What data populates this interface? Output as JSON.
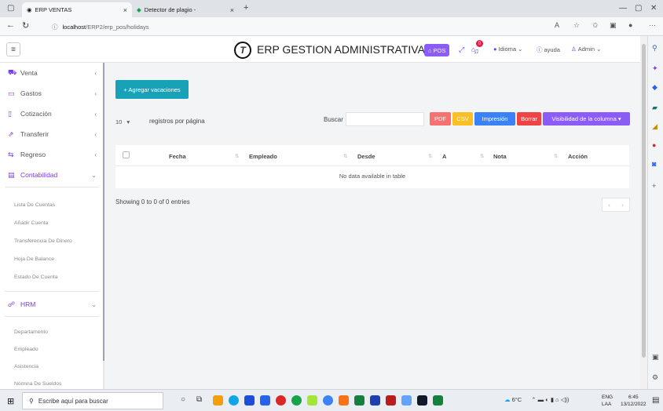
{
  "browser": {
    "tabs": [
      {
        "title": "ERP VENTAS",
        "active": true
      },
      {
        "title": "Detector de plagio -",
        "active": false
      }
    ],
    "new_tab": "+",
    "url_host": "localhost",
    "url_path": "/ERP2/erp_pos/holidays",
    "window_controls": {
      "minimize": "—",
      "restore": "▢",
      "close": "✕"
    }
  },
  "header": {
    "logo_glyph": "T",
    "title": "ERP GESTION ADMINISTRATIVA",
    "pos_label": "POS",
    "notification_count": "0",
    "language_label": "Idioma",
    "help_label": "ayuda",
    "user_label": "Admin"
  },
  "sidebar": {
    "items": [
      {
        "label": "Venta",
        "icon": "cart-icon"
      },
      {
        "label": "Gastos",
        "icon": "folder-icon"
      },
      {
        "label": "Cotización",
        "icon": "document-icon"
      },
      {
        "label": "Transferir",
        "icon": "share-icon"
      },
      {
        "label": "Regreso",
        "icon": "return-icon"
      },
      {
        "label": "Contabilidad",
        "icon": "accounting-icon"
      }
    ],
    "contabilidad_sub": [
      "Lista De Cuentas",
      "Añadir Cuenta",
      "Transferencia De Dinero",
      "Hoja De Balance",
      "Estado De Cuenta"
    ],
    "hrm_label": "HRM",
    "hrm_sub": [
      "Departamento",
      "Empleado",
      "Asistencia",
      "Nómina De Sueldos"
    ]
  },
  "content": {
    "add_button": "+ Agregar vacaciones",
    "page_length": "10",
    "page_length_label": "registros por página",
    "search_label": "Buscar",
    "search_value": "",
    "export_buttons": [
      {
        "label": "PDF",
        "color": "#f87171"
      },
      {
        "label": "CSV",
        "color": "#fbbf24"
      },
      {
        "label": "Impresión",
        "color": "#3b82f6"
      },
      {
        "label": "Borrar",
        "color": "#ef4444"
      },
      {
        "label": "Visibilidad de la columna ▾",
        "color": "#8b5cf6"
      }
    ],
    "columns": [
      "Fecha",
      "Empleado",
      "Desde",
      "A",
      "Nota",
      "Acción"
    ],
    "no_data": "No data available in table",
    "info": "Showing 0 to 0 of 0 entries",
    "pager_prev": "‹",
    "pager_next": "›"
  },
  "taskbar": {
    "search_placeholder": "Escribe aquí para buscar",
    "weather": "6°C",
    "lang_top": "ENG",
    "lang_bottom": "LAA",
    "time": "6:45",
    "date": "13/12/2022"
  }
}
